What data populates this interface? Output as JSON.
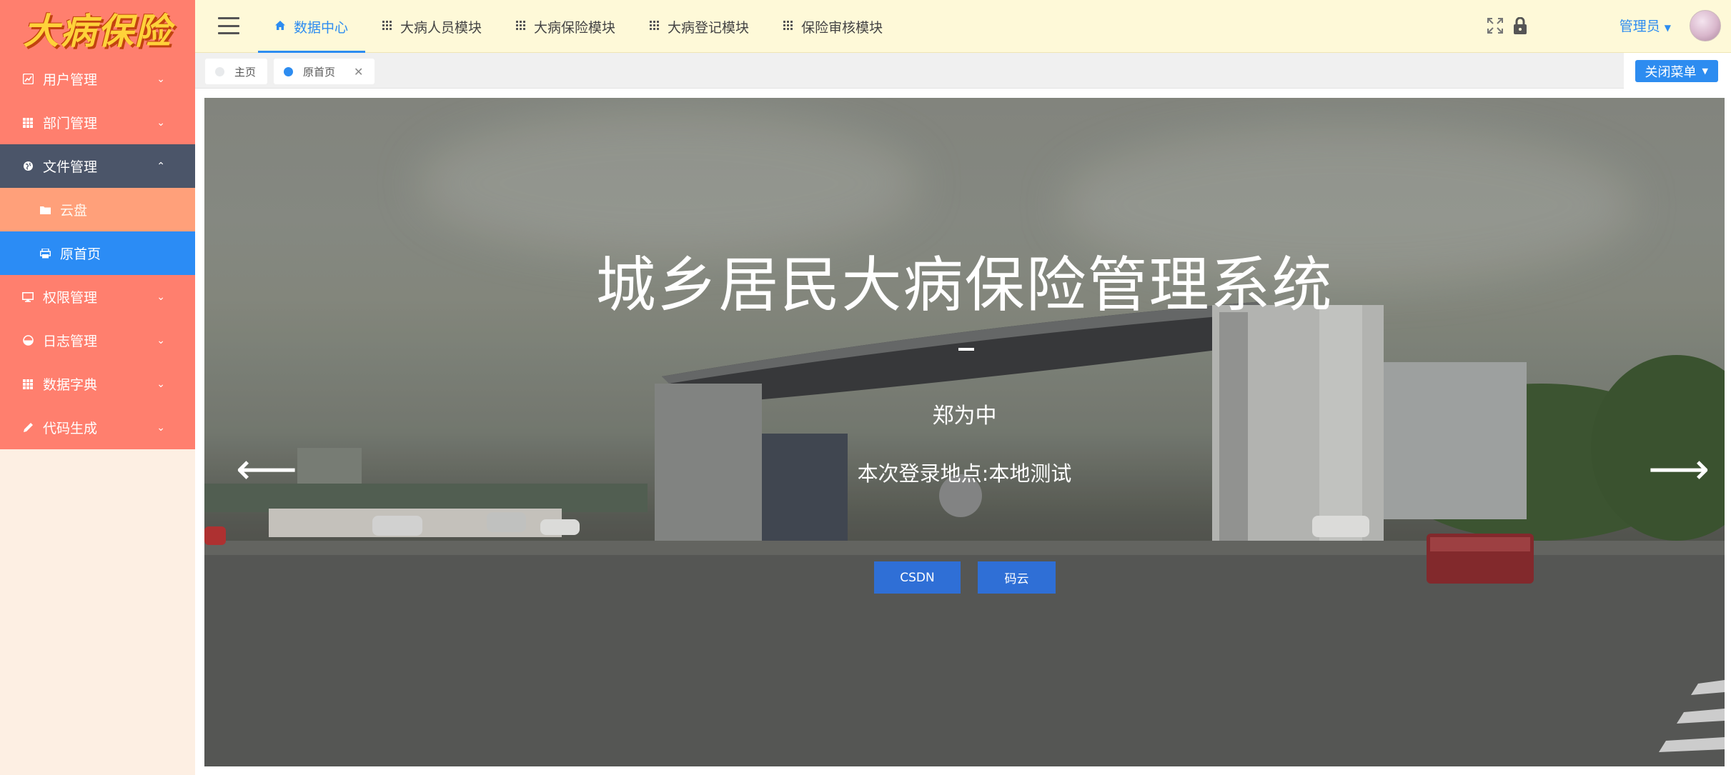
{
  "sidebar": {
    "logo_text": "大病保险",
    "items": [
      {
        "label": "用户管理",
        "icon": "user-chart-icon",
        "chevron": "chevron-down-icon"
      },
      {
        "label": "部门管理",
        "icon": "grid-icon",
        "chevron": "chevron-down-icon"
      },
      {
        "label": "文件管理",
        "icon": "globe-icon",
        "chevron": "chevron-up-icon",
        "open": true
      },
      {
        "label": "云盘",
        "icon": "folder-icon",
        "sub": true
      },
      {
        "label": "原首页",
        "icon": "print-icon",
        "sub": true,
        "active": true
      },
      {
        "label": "权限管理",
        "icon": "monitor-icon",
        "chevron": "chevron-down-icon"
      },
      {
        "label": "日志管理",
        "icon": "pie-icon",
        "chevron": "chevron-down-icon"
      },
      {
        "label": "数据字典",
        "icon": "grid-icon",
        "chevron": "chevron-down-icon"
      },
      {
        "label": "代码生成",
        "icon": "pencil-icon",
        "chevron": "chevron-down-icon"
      }
    ]
  },
  "header": {
    "tabs": [
      {
        "label": "数据中心",
        "icon": "home-icon",
        "active": true
      },
      {
        "label": "大病人员模块",
        "icon": "grid-icon"
      },
      {
        "label": "大病保险模块",
        "icon": "grid-icon"
      },
      {
        "label": "大病登记模块",
        "icon": "grid-icon"
      },
      {
        "label": "保险审核模块",
        "icon": "grid-icon"
      }
    ],
    "user_label": "管理员"
  },
  "tabsbar": {
    "tabs": [
      {
        "label": "主页"
      },
      {
        "label": "原首页",
        "active": true
      }
    ],
    "close_menu_label": "关闭菜单"
  },
  "banner": {
    "title": "城乡居民大病保险管理系统",
    "name": "郑为中",
    "location": "本次登录地点:本地测试",
    "button_csdn": "CSDN",
    "button_gitee": "码云",
    "left_arrow": "⟵",
    "right_arrow": "⟶"
  },
  "colors": {
    "sidebar_bg": "#ff7f6e",
    "sidebar_open": "#4b5569",
    "sidebar_sub": "#ffa07a",
    "active_blue": "#2d8cf0",
    "header_bg": "#fef9d8",
    "banner_button": "#2f6fd6"
  }
}
